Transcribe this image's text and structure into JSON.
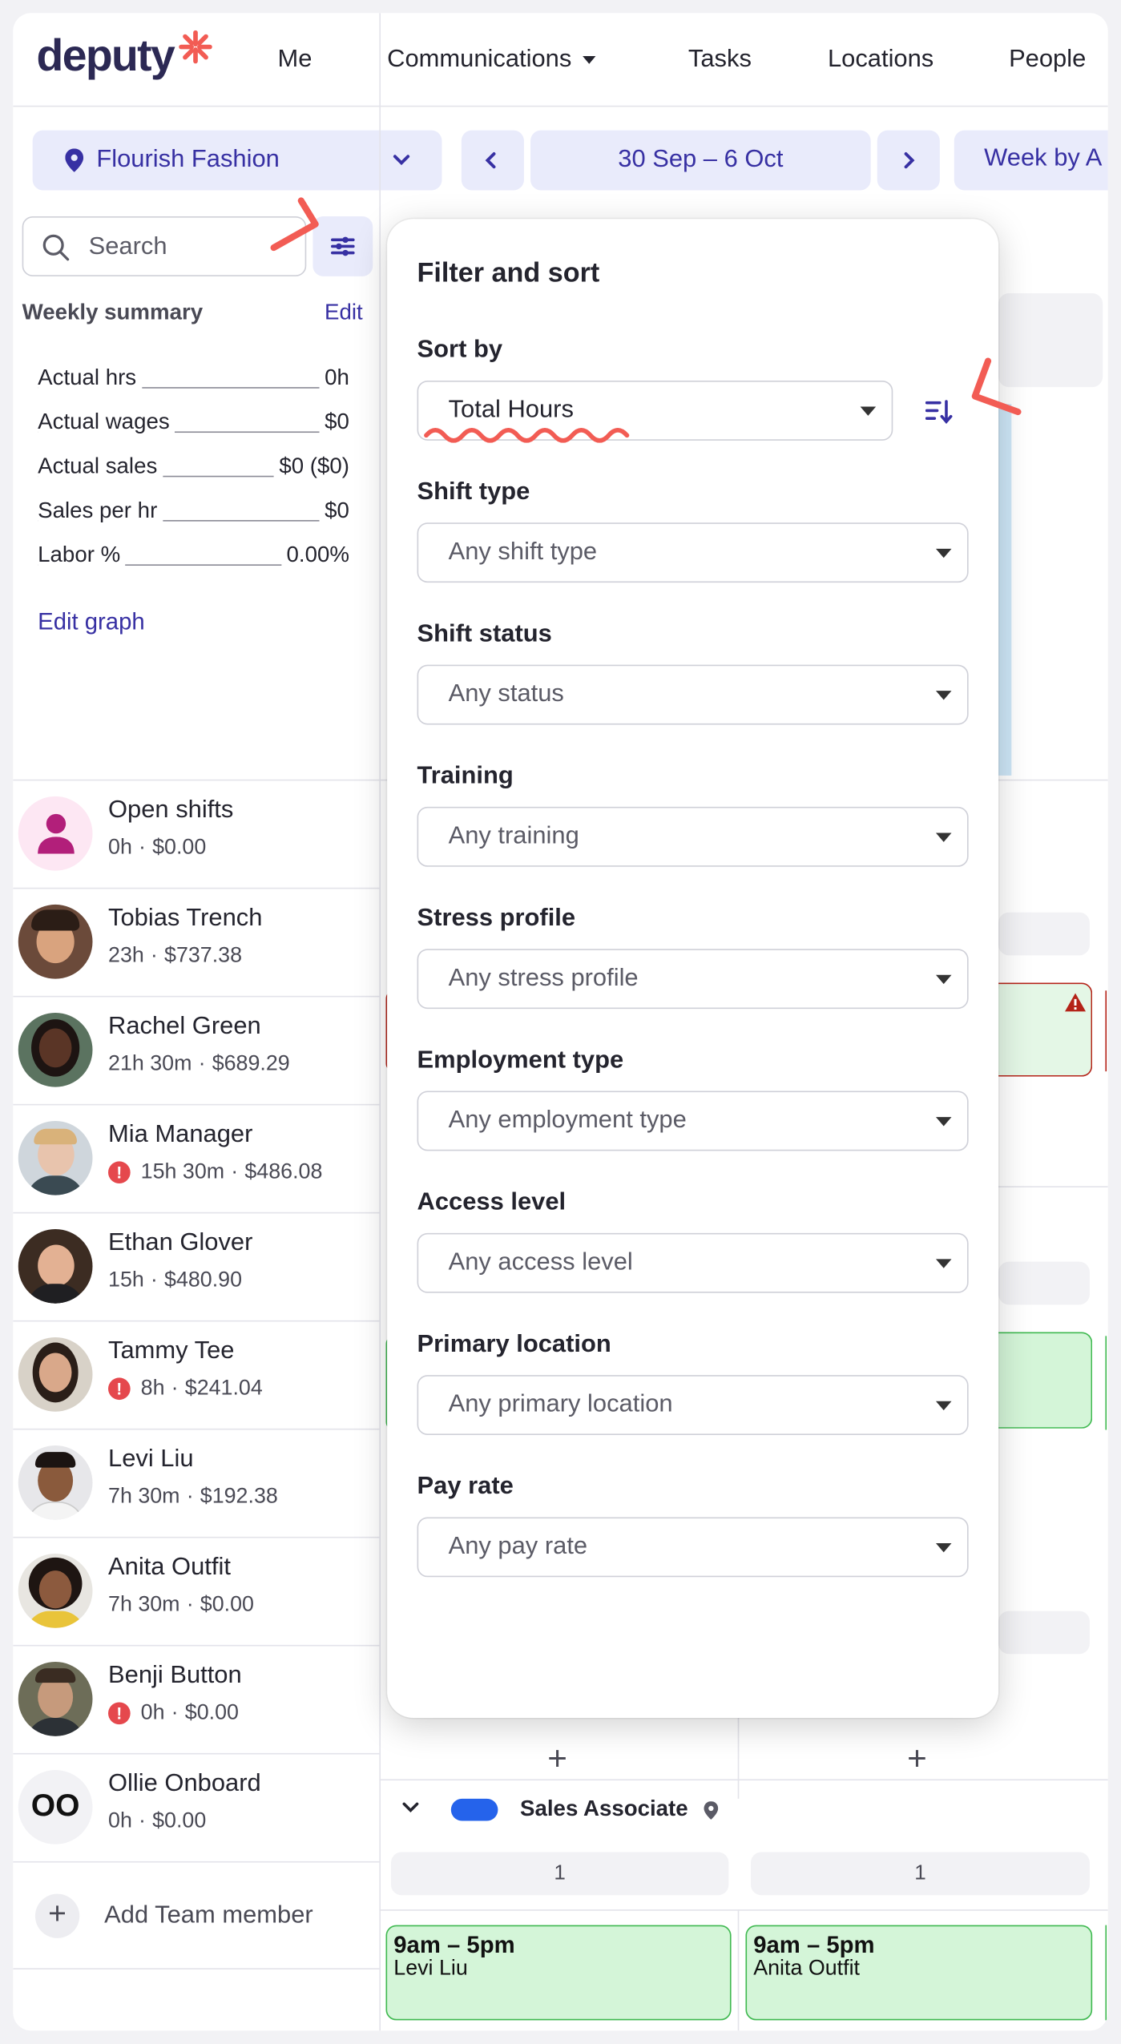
{
  "brand": {
    "name": "deputy",
    "accent": "#3730a3",
    "annotation_color": "#f25c54"
  },
  "nav": {
    "items": [
      "Me",
      "Communications",
      "Tasks",
      "Locations",
      "People"
    ]
  },
  "toolbar": {
    "location": "Flourish Fashion",
    "date_range": "30 Sep – 6 Oct",
    "view": "Week by A"
  },
  "search": {
    "placeholder": "Search"
  },
  "summary": {
    "title": "Weekly summary",
    "edit_label": "Edit",
    "rows": [
      {
        "label": "Actual hrs",
        "value": "0h"
      },
      {
        "label": "Actual wages",
        "value": "$0"
      },
      {
        "label": "Actual sales",
        "value": "$0 ($0)"
      },
      {
        "label": "Sales per hr",
        "value": "$0"
      },
      {
        "label": "Labor %",
        "value": "0.00%"
      }
    ],
    "edit_graph": "Edit graph"
  },
  "people": [
    {
      "name": "Open shifts",
      "hours": "0h",
      "cost": "$0.00",
      "warning": false
    },
    {
      "name": "Tobias Trench",
      "hours": "23h",
      "cost": "$737.38",
      "warning": false
    },
    {
      "name": "Rachel Green",
      "hours": "21h 30m",
      "cost": "$689.29",
      "warning": false
    },
    {
      "name": "Mia Manager",
      "hours": "15h 30m",
      "cost": "$486.08",
      "warning": true
    },
    {
      "name": "Ethan Glover",
      "hours": "15h",
      "cost": "$480.90",
      "warning": false
    },
    {
      "name": "Tammy Tee",
      "hours": "8h",
      "cost": "$241.04",
      "warning": true
    },
    {
      "name": "Levi Liu",
      "hours": "7h 30m",
      "cost": "$192.38",
      "warning": false
    },
    {
      "name": "Anita Outfit",
      "hours": "7h 30m",
      "cost": "$0.00",
      "warning": false
    },
    {
      "name": "Benji Button",
      "hours": "0h",
      "cost": "$0.00",
      "warning": true
    },
    {
      "name": "Ollie Onboard",
      "hours": "0h",
      "cost": "$0.00",
      "warning": false,
      "initials": "OO"
    }
  ],
  "add_member": "Add Team member",
  "area": {
    "name": "Sales Associate",
    "color": "#2563eb"
  },
  "counts": [
    "1",
    "1"
  ],
  "shifts": [
    {
      "time": "9am – 5pm",
      "name": "Levi Liu"
    },
    {
      "time": "9am – 5pm",
      "name": "Anita Outfit"
    }
  ],
  "filter": {
    "title": "Filter and sort",
    "sort_label": "Sort by",
    "sort_value": "Total Hours",
    "fields": [
      {
        "label": "Shift type",
        "value": "Any shift type"
      },
      {
        "label": "Shift status",
        "value": "Any status"
      },
      {
        "label": "Training",
        "value": "Any training"
      },
      {
        "label": "Stress profile",
        "value": "Any stress profile"
      },
      {
        "label": "Employment type",
        "value": "Any employment type"
      },
      {
        "label": "Access level",
        "value": "Any access level"
      },
      {
        "label": "Primary location",
        "value": "Any primary location"
      },
      {
        "label": "Pay rate",
        "value": "Any pay rate"
      }
    ]
  }
}
